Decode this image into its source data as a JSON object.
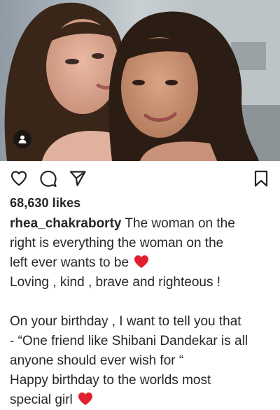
{
  "post": {
    "likes_text": "68,630 likes",
    "username": "rhea_chakraborty",
    "caption_lines": [
      " The woman on the",
      "right is everything the woman on the",
      "left ever wants to be ",
      "Loving , kind , brave and righteous !",
      "",
      "On your birthday , I want to tell you that",
      "- “One friend like Shibani Dandekar is all",
      "anyone should ever wish for “",
      "Happy birthday to the worlds most",
      "special girl "
    ]
  },
  "icons": {
    "like": "heart-outline-icon",
    "comment": "comment-bubble-icon",
    "share": "paper-plane-icon",
    "save": "bookmark-icon",
    "tag": "user-tag-icon",
    "emoji": "red-heart-emoji"
  },
  "colors": {
    "text": "#262626",
    "emoji_heart": "#e0202e"
  }
}
